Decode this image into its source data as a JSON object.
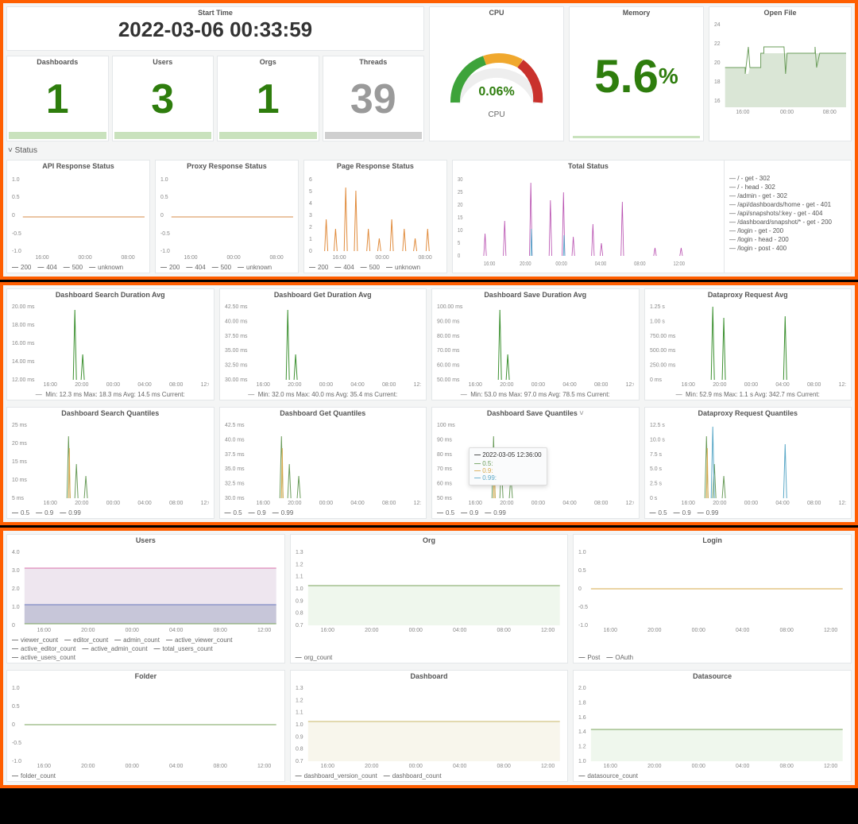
{
  "top": {
    "start_time": {
      "title": "Start Time",
      "value": "2022-03-06 00:33:59"
    },
    "stats": [
      {
        "title": "Dashboards",
        "value": "1",
        "color": "#2e7d0d",
        "bar": "#c9e2bd"
      },
      {
        "title": "Users",
        "value": "3",
        "color": "#2e7d0d",
        "bar": "#c9e2bd"
      },
      {
        "title": "Orgs",
        "value": "1",
        "color": "#2e7d0d",
        "bar": "#c9e2bd"
      },
      {
        "title": "Threads",
        "value": "39",
        "color": "#9a9a9a",
        "bar": "#cfcfcf"
      }
    ],
    "cpu": {
      "title": "CPU",
      "value": "0.06%",
      "label": "CPU"
    },
    "memory": {
      "title": "Memory",
      "value": "5.6",
      "unit": "%"
    },
    "openfile": {
      "title": "Open File"
    }
  },
  "status": {
    "section": "Status",
    "panels": [
      {
        "title": "API Response Status",
        "legend": [
          "200",
          "404",
          "500",
          "unknown"
        ]
      },
      {
        "title": "Proxy Response Status",
        "legend": [
          "200",
          "404",
          "500",
          "unknown"
        ]
      },
      {
        "title": "Page Response Status",
        "legend": [
          "200",
          "404",
          "500",
          "unknown"
        ]
      },
      {
        "title": "Total Status",
        "legend": [
          "/ - get - 302",
          "/ - head - 302",
          "/admin - get - 302",
          "/api/dashboards/home - get - 401",
          "/api/snapshots/:key - get - 404",
          "/dashboard/snapshot/* - get - 200",
          "/login - get - 200",
          "/login - head - 200",
          "/login - post - 400"
        ]
      }
    ]
  },
  "dash": {
    "row1": [
      {
        "title": "Dashboard Search Duration Avg",
        "stats": "Min: 12.3 ms  Max: 18.3 ms  Avg: 14.5 ms  Current:",
        "ylabels": [
          "20.00 ms",
          "18.00 ms",
          "16.00 ms",
          "14.00 ms",
          "12.00 ms"
        ]
      },
      {
        "title": "Dashboard Get Duration Avg",
        "stats": "Min: 32.0 ms  Max: 40.0 ms  Avg: 35.4 ms  Current:",
        "ylabels": [
          "42.50 ms",
          "40.00 ms",
          "37.50 ms",
          "35.00 ms",
          "32.50 ms",
          "30.00 ms"
        ]
      },
      {
        "title": "Dashboard Save Duration Avg",
        "stats": "Min: 53.0 ms  Max: 97.0 ms  Avg: 78.5 ms  Current:",
        "ylabels": [
          "100.00 ms",
          "90.00 ms",
          "80.00 ms",
          "70.00 ms",
          "60.00 ms",
          "50.00 ms"
        ]
      },
      {
        "title": "Dataproxy Request Avg",
        "stats": "Min: 52.9 ms  Max: 1.1 s  Avg: 342.7 ms  Current:",
        "ylabels": [
          "1.25 s",
          "1.00 s",
          "750.00 ms",
          "500.00 ms",
          "250.00 ms",
          "0 ms"
        ]
      }
    ],
    "row2": [
      {
        "title": "Dashboard Search Quantiles",
        "legend": [
          "0.5",
          "0.9",
          "0.99"
        ],
        "ylabels": [
          "25 ms",
          "20 ms",
          "15 ms",
          "10 ms",
          "5 ms"
        ]
      },
      {
        "title": "Dashboard Get Quantiles",
        "legend": [
          "0.5",
          "0.9",
          "0.99"
        ],
        "ylabels": [
          "42.5 ms",
          "40.0 ms",
          "37.5 ms",
          "35.0 ms",
          "32.5 ms",
          "30.0 ms"
        ]
      },
      {
        "title": "Dashboard Save Quantiles",
        "legend": [
          "0.5",
          "0.9",
          "0.99"
        ],
        "ylabels": [
          "100 ms",
          "90 ms",
          "80 ms",
          "70 ms",
          "60 ms",
          "50 ms"
        ],
        "tooltip": {
          "time": "2022-03-05 12:36:00",
          "rows": [
            "0.5:",
            "0.9:",
            "0.99:"
          ]
        }
      },
      {
        "title": "Dataproxy Request Quantiles",
        "legend": [
          "0.5",
          "0.9",
          "0.99"
        ],
        "ylabels": [
          "12.5 s",
          "10.0 s",
          "7.5 s",
          "5.0 s",
          "2.5 s",
          "0 s"
        ]
      }
    ]
  },
  "bottom": {
    "row1": [
      {
        "title": "Users",
        "legend": [
          "viewer_count",
          "editor_count",
          "admin_count",
          "active_viewer_count",
          "active_editor_count",
          "active_admin_count",
          "total_users_count",
          "active_users_count"
        ],
        "ylabels": [
          "4.0",
          "3.0",
          "2.0",
          "1.0",
          "0"
        ]
      },
      {
        "title": "Org",
        "legend": [
          "org_count"
        ],
        "ylabels": [
          "1.3",
          "1.2",
          "1.1",
          "1.0",
          "0.9",
          "0.8",
          "0.7"
        ]
      },
      {
        "title": "Login",
        "legend": [
          "Post",
          "OAuth"
        ],
        "ylabels": [
          "1.0",
          "0.5",
          "0",
          "-0.5",
          "-1.0"
        ]
      }
    ],
    "row2": [
      {
        "title": "Folder",
        "legend": [
          "folder_count"
        ],
        "ylabels": [
          "1.0",
          "0.5",
          "0",
          "-0.5",
          "-1.0"
        ]
      },
      {
        "title": "Dashboard",
        "legend": [
          "dashboard_version_count",
          "dashboard_count"
        ],
        "ylabels": [
          "1.3",
          "1.2",
          "1.1",
          "1.0",
          "0.9",
          "0.8",
          "0.7"
        ]
      },
      {
        "title": "Datasource",
        "legend": [
          "datasource_count"
        ],
        "ylabels": [
          "2.0",
          "1.8",
          "1.6",
          "1.4",
          "1.2",
          "1.0"
        ]
      }
    ]
  },
  "xticks_short": [
    "16:00",
    "00:00",
    "08:00"
  ],
  "xticks_med": [
    "16:00",
    "20:00",
    "00:00",
    "04:00",
    "08:00",
    "12:00"
  ],
  "chart_data": {
    "type": "dashboard",
    "memory_pct": 5.6,
    "cpu_pct": 0.06,
    "open_file_range": [
      16,
      24
    ],
    "page_response_ymax": 6,
    "total_status_ymax": 30,
    "users_lines": {
      "total_users_count": 3,
      "admin_count": 1,
      "others": 0
    },
    "org_count": 1,
    "dashboard_lines": {
      "dashboard_version_count": 1,
      "dashboard_count": 1
    },
    "datasource_count": 1.5,
    "login_lines": {
      "Post": 0,
      "OAuth": 0
    },
    "folder_count": 0
  }
}
